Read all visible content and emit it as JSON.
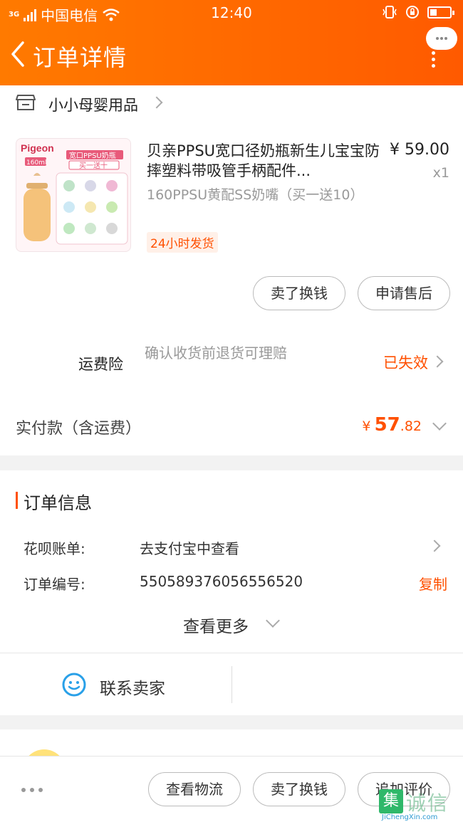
{
  "status_bar": {
    "network": "3G",
    "carrier": "中国电信",
    "time": "12:40"
  },
  "header": {
    "title": "订单详情"
  },
  "shop": {
    "name": "小小母婴用品"
  },
  "product": {
    "title": "贝亲PPSU宽口径奶瓶新生儿宝宝防摔塑料带吸管手柄配件...",
    "spec": "160PPSU黄配SS奶嘴（买一送10）",
    "tag": "24小时发货",
    "price": "¥ 59.00",
    "quantity": "x1",
    "image_brand": "Pigeon",
    "image_text": "宽口PPSU奶瓶",
    "image_promo": "买一送十",
    "image_size": "160ml",
    "actions": [
      "卖了换钱",
      "申请售后"
    ]
  },
  "shipping_insurance": {
    "label": "运费险",
    "description": "确认收货前退货可理赔",
    "status": "已失效",
    "status_color": "#ff5000"
  },
  "payment": {
    "label": "实付款（含运费）",
    "currency": "¥",
    "integer": "57",
    "decimal": ".82"
  },
  "order_info": {
    "title": "订单信息",
    "rows": [
      {
        "label": "花呗账单:",
        "value": "去支付宝中查看"
      },
      {
        "label": "订单编号:",
        "value": "550589376056556520",
        "action": "复制"
      }
    ],
    "see_more": "查看更多"
  },
  "contact": {
    "label": "联系卖家"
  },
  "bottom_actions": [
    "查看物流",
    "卖了换钱",
    "追加评价"
  ],
  "watermark": {
    "mark": "集",
    "text": "诚信",
    "url": "JiChengXin.com"
  },
  "colors": {
    "accent": "#ff5000",
    "header_start": "#ff7a00",
    "header_end": "#ff5a00"
  }
}
